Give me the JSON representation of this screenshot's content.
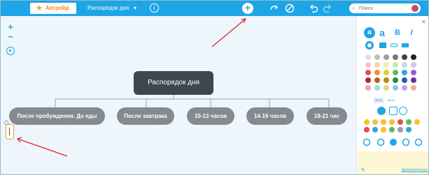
{
  "topbar": {
    "upgrade_label": "Апгрейд",
    "map_title": "Распорядок дня",
    "title_caret": "▾",
    "info_icon": "i",
    "add_icon": "+",
    "search_placeholder": "Поиск"
  },
  "canvas": {
    "zoom_in": "+",
    "zoom_out": "−",
    "root": "Распорядок дня",
    "children": [
      "После пробуждения. До еды",
      "После завтрака",
      "10-13 часов",
      "14-16 часов",
      "18-21 час"
    ]
  },
  "panel": {
    "format_labels": [
      "a",
      "a",
      "B",
      "I"
    ],
    "mini_tabs": [
      "Tema",
      "Mood"
    ],
    "more_link": "Дополнительно..."
  },
  "colors": {
    "accent": "#1ea5e5",
    "root_node": "#3c474f",
    "child_node": "#838a90",
    "canvas_bg": "#eef5fb",
    "arrow": "#e02030"
  }
}
